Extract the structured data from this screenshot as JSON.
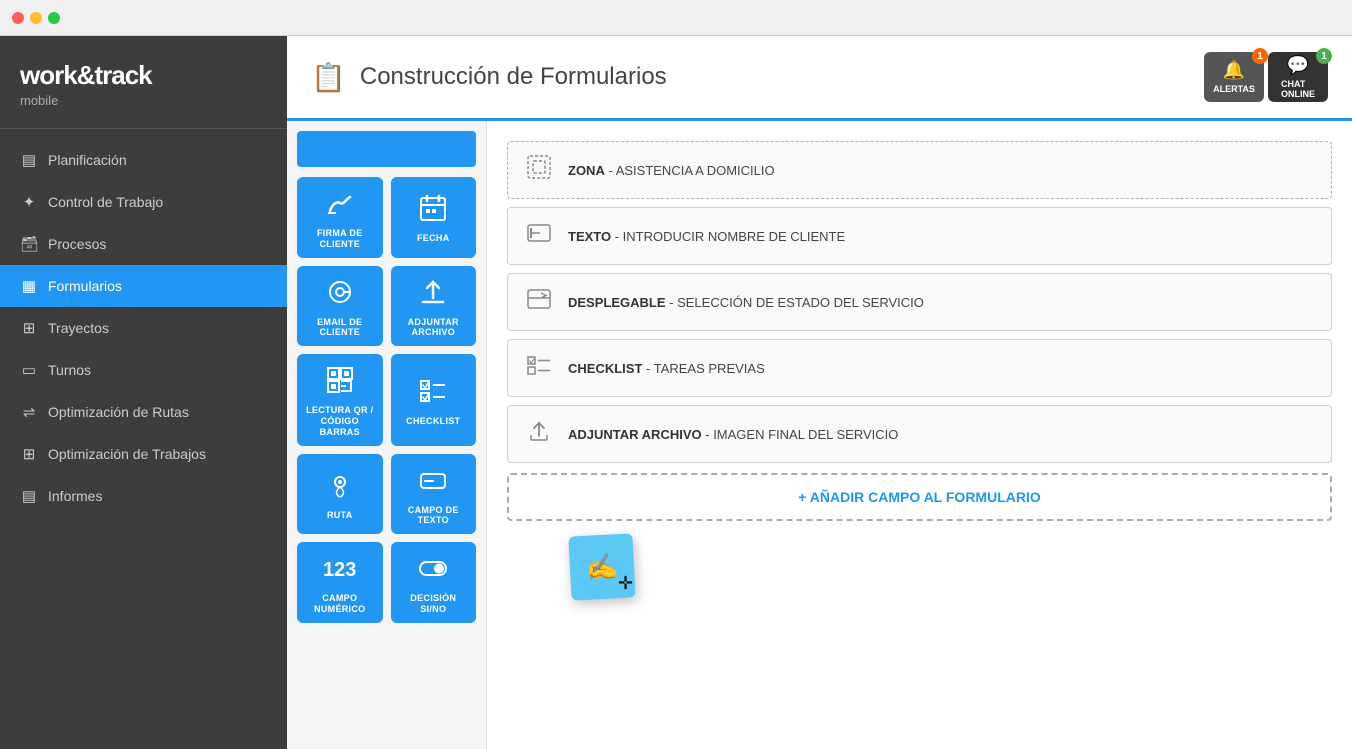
{
  "window": {
    "dots": [
      "red",
      "yellow",
      "green"
    ]
  },
  "sidebar": {
    "logo": "work&track",
    "logo_sub": "mobile",
    "nav_items": [
      {
        "id": "planificacion",
        "label": "Planificación",
        "icon": "▤",
        "active": false
      },
      {
        "id": "control-trabajo",
        "label": "Control de Trabajo",
        "icon": "✦",
        "active": false
      },
      {
        "id": "procesos",
        "label": "Procesos",
        "icon": "🗃",
        "active": false
      },
      {
        "id": "formularios",
        "label": "Formularios",
        "icon": "▦",
        "active": true
      },
      {
        "id": "trayectos",
        "label": "Trayectos",
        "icon": "⊞",
        "active": false
      },
      {
        "id": "turnos",
        "label": "Turnos",
        "icon": "▭",
        "active": false
      },
      {
        "id": "optimizacion-rutas",
        "label": "Optimización de Rutas",
        "icon": "⇌",
        "active": false
      },
      {
        "id": "optimizacion-trabajos",
        "label": "Optimización de Trabajos",
        "icon": "⊞",
        "active": false
      },
      {
        "id": "informes",
        "label": "Informes",
        "icon": "▤",
        "active": false
      }
    ]
  },
  "header": {
    "title": "Construcción de Formularios",
    "icon": "📋",
    "alertas_label": "ALERTAS",
    "alertas_badge": "1",
    "chat_label": "CHAT\nONLINE",
    "chat_badge": "1"
  },
  "palette": {
    "items": [
      {
        "id": "firma",
        "icon": "✍",
        "label": "FIRMA DE CLIENTE"
      },
      {
        "id": "fecha",
        "icon": "⊞",
        "label": "FECHA"
      },
      {
        "id": "email",
        "icon": "@",
        "label": "EMAIL DE CLIENTE"
      },
      {
        "id": "adjuntar",
        "icon": "⬆",
        "label": "ADJUNTAR ARCHIVO"
      },
      {
        "id": "qr",
        "icon": "▦",
        "label": "LECTURA QR / CÓDIGO BARRAS"
      },
      {
        "id": "checklist",
        "icon": "☑",
        "label": "CHECKLIST"
      },
      {
        "id": "ruta",
        "icon": "◎",
        "label": "RUTA"
      },
      {
        "id": "campo-texto",
        "icon": "▭",
        "label": "CAMPO DE TEXTO"
      },
      {
        "id": "campo-numerico",
        "icon": "123",
        "label": "CAMPO NUMÉRICO"
      },
      {
        "id": "decision",
        "icon": "⊙",
        "label": "DECISIÓN SI/NO"
      }
    ]
  },
  "form_fields": [
    {
      "id": "zona",
      "type": "ZONA",
      "description": "ASISTENCIA A DOMICILIO",
      "icon": "zone",
      "zone": true
    },
    {
      "id": "texto",
      "type": "TEXTO",
      "description": "INTRODUCIR NOMBRE DE CLIENTE",
      "icon": "text"
    },
    {
      "id": "desplegable",
      "type": "DESPLEGABLE",
      "description": "SELECCIÓN DE ESTADO DEL SERVICIO",
      "icon": "dropdown"
    },
    {
      "id": "checklist",
      "type": "CHECKLIST",
      "description": "TAREAS PREVIAS",
      "icon": "checklist"
    },
    {
      "id": "adjuntar-archivo",
      "type": "ADJUNTAR ARCHIVO",
      "description": "IMAGEN FINAL DEL SERVICIO",
      "icon": "upload"
    }
  ],
  "add_field_label": "+ AÑADIR CAMPO AL FORMULARIO",
  "drag_ghost_icon": "✍"
}
